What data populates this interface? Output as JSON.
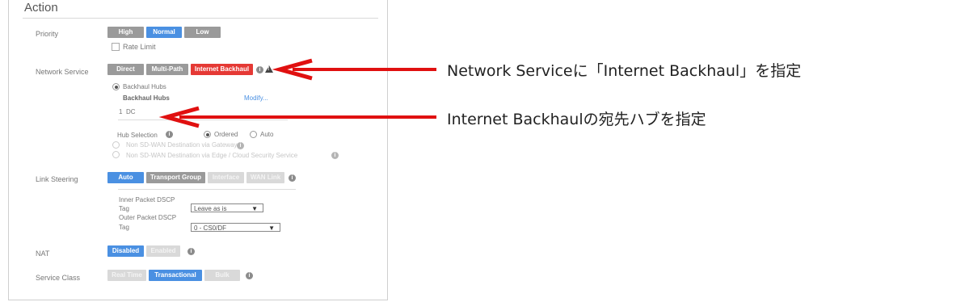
{
  "section_title": "Action",
  "priority": {
    "label": "Priority",
    "options": [
      "High",
      "Normal",
      "Low"
    ],
    "selected": "Normal",
    "rate_limit_label": "Rate Limit"
  },
  "network_service": {
    "label": "Network Service",
    "options": [
      "Direct",
      "Multi-Path",
      "Internet Backhaul"
    ],
    "selected": "Internet Backhaul",
    "backhaul_hubs_label": "Backhaul Hubs",
    "hubs_column": "Backhaul Hubs",
    "modify_link": "Modify...",
    "hub_index": "1",
    "hub_name": "DC",
    "hub_selection_label": "Hub Selection",
    "ordered_label": "Ordered",
    "auto_label": "Auto",
    "non_sdwan_gateway": "Non SD-WAN Destination via Gateway",
    "non_sdwan_edge": "Non SD-WAN Destination via Edge / Cloud Security Service"
  },
  "link_steering": {
    "label": "Link Steering",
    "options": [
      "Auto",
      "Transport Group",
      "Interface",
      "WAN Link"
    ],
    "selected": "Auto",
    "inner_dscp_line1": "Inner Packet DSCP",
    "inner_dscp_line2": "Tag",
    "inner_dscp_value": "Leave as is",
    "outer_dscp_line1": "Outer Packet DSCP",
    "outer_dscp_line2": "Tag",
    "outer_dscp_value": "0 - CS0/DF"
  },
  "nat": {
    "label": "NAT",
    "options": [
      "Disabled",
      "Enabled"
    ],
    "selected": "Disabled"
  },
  "service_class": {
    "label": "Service Class",
    "options": [
      "Real Time",
      "Transactional",
      "Bulk"
    ],
    "selected": "Transactional"
  },
  "annotations": {
    "callout_1": "Network Serviceに「Internet Backhaul」を指定",
    "callout_2": "Internet Backhaulの宛先ハブを指定",
    "arrow_color": "#e01010"
  }
}
